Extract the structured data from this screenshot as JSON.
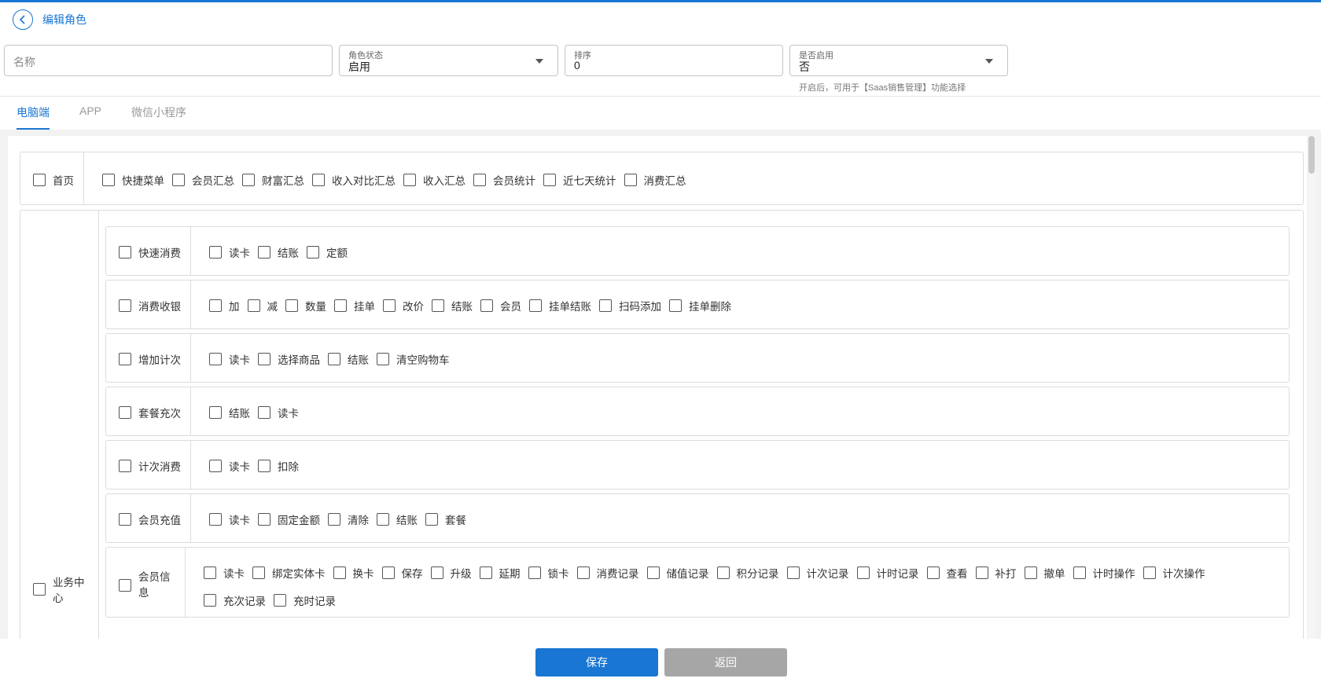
{
  "header": {
    "title": "编辑角色"
  },
  "form": {
    "name": {
      "placeholder": "名称"
    },
    "status": {
      "label": "角色状态",
      "value": "启用"
    },
    "sort": {
      "label": "排序",
      "value": "0"
    },
    "enabled": {
      "label": "是否启用",
      "value": "否",
      "helper": "开启后，可用于【Saas销售管理】功能选择"
    }
  },
  "tabs": [
    {
      "label": "电脑端",
      "active": true
    },
    {
      "label": "APP",
      "active": false
    },
    {
      "label": "微信小程序",
      "active": false
    }
  ],
  "permissions": {
    "home": {
      "label": "首页",
      "items": [
        "快捷菜单",
        "会员汇总",
        "财富汇总",
        "收入对比汇总",
        "收入汇总",
        "会员统计",
        "近七天统计",
        "消费汇总"
      ]
    },
    "business": {
      "label": "业务中心",
      "modules": [
        {
          "label": "快速消费",
          "items": [
            "读卡",
            "结账",
            "定额"
          ]
        },
        {
          "label": "消费收银",
          "items": [
            "加",
            "减",
            "数量",
            "挂单",
            "改价",
            "结账",
            "会员",
            "挂单结账",
            "扫码添加",
            "挂单删除"
          ]
        },
        {
          "label": "增加计次",
          "items": [
            "读卡",
            "选择商品",
            "结账",
            "清空购物车"
          ]
        },
        {
          "label": "套餐充次",
          "items": [
            "结账",
            "读卡"
          ]
        },
        {
          "label": "计次消费",
          "items": [
            "读卡",
            "扣除"
          ]
        },
        {
          "label": "会员充值",
          "items": [
            "读卡",
            "固定金额",
            "清除",
            "结账",
            "套餐"
          ]
        },
        {
          "label": "会员信息",
          "items": [
            "读卡",
            "绑定实体卡",
            "换卡",
            "保存",
            "升级",
            "延期",
            "锁卡",
            "消费记录",
            "储值记录",
            "积分记录",
            "计次记录",
            "计时记录",
            "查看",
            "补打",
            "撤单",
            "计时操作",
            "计次操作",
            "充次记录",
            "充时记录"
          ]
        }
      ]
    }
  },
  "footer": {
    "save": "保存",
    "back": "返回"
  },
  "colors": {
    "primary": "#1976d2",
    "secondary_button": "#a6a6a6"
  }
}
